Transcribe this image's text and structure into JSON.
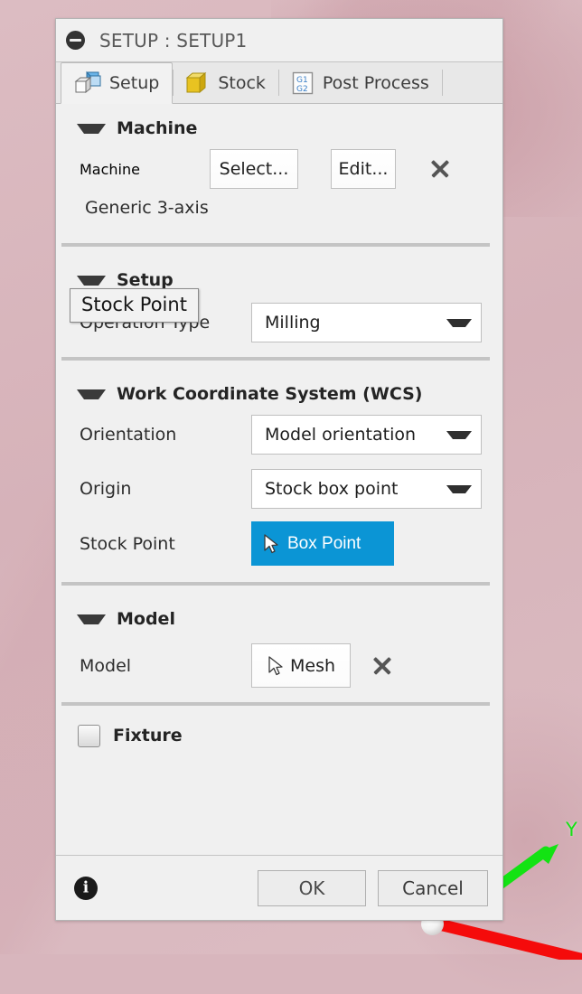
{
  "window": {
    "title": "SETUP : SETUP1",
    "collapse_icon": "collapse-circle-icon"
  },
  "tabs": [
    {
      "label": "Setup",
      "icon": "setup-boxes-icon",
      "active": true
    },
    {
      "label": "Stock",
      "icon": "stock-cube-icon",
      "active": false
    },
    {
      "label": "Post Process",
      "icon": "gcode-document-icon",
      "active": false
    }
  ],
  "tooltip": {
    "text": "Stock Point"
  },
  "sections": {
    "machine": {
      "heading": "Machine",
      "row_label": "Machine",
      "select_button": "Select...",
      "edit_button": "Edit...",
      "clear_icon": "close-x-icon",
      "machine_name": "Generic 3-axis"
    },
    "setup": {
      "heading": "Setup",
      "operation_type_label": "Operation Type",
      "operation_type_value": "Milling"
    },
    "wcs": {
      "heading": "Work Coordinate System (WCS)",
      "orientation_label": "Orientation",
      "orientation_value": "Model orientation",
      "origin_label": "Origin",
      "origin_value": "Stock box point",
      "stock_point_label": "Stock Point",
      "stock_point_button": "Box Point"
    },
    "model": {
      "heading": "Model",
      "row_label": "Model",
      "select_button": "Mesh",
      "clear_icon": "close-x-icon"
    },
    "fixture": {
      "label": "Fixture",
      "checked": false
    }
  },
  "footer": {
    "info_icon": "info-icon",
    "ok_label": "OK",
    "cancel_label": "Cancel"
  },
  "viewport": {
    "axis_y_label": "Y"
  },
  "colors": {
    "accent_blue": "#0b95d5",
    "dialog_bg": "#f0f0f0",
    "background": "#d8b6bd",
    "axis_y": "#13e313",
    "axis_x": "#f50b0b"
  }
}
